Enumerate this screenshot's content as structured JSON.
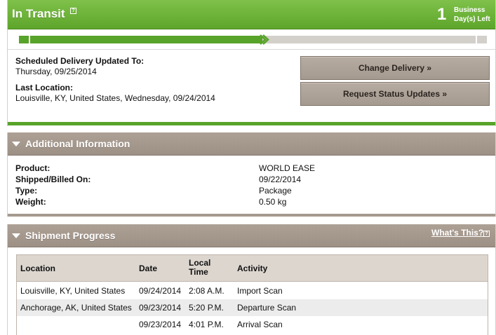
{
  "status": {
    "title": "In Transit",
    "days_count": "1",
    "days_label_line1": "Business",
    "days_label_line2": "Day(s) Left",
    "progress_fraction": 0.52,
    "colors": {
      "green": "#5ea52b",
      "taupe": "#a59a8f"
    }
  },
  "delivery": {
    "scheduled_label": "Scheduled Delivery Updated To:",
    "scheduled_value": "Thursday, 09/25/2014",
    "last_location_label": "Last Location:",
    "last_location_value": "Louisville, KY, United States, Wednesday, 09/24/2014"
  },
  "actions": {
    "change_delivery": "Change Delivery »",
    "request_updates": "Request Status Updates »"
  },
  "additional_info": {
    "title": "Additional Information",
    "rows": [
      {
        "key": "Product:",
        "value": "WORLD EASE"
      },
      {
        "key": "Shipped/Billed On:",
        "value": "09/22/2014"
      },
      {
        "key": "Type:",
        "value": "Package"
      },
      {
        "key": "Weight:",
        "value": "0.50 kg"
      }
    ]
  },
  "shipment_progress": {
    "title": "Shipment Progress",
    "whats_this": "What's This?",
    "headers": {
      "location": "Location",
      "date": "Date",
      "local_time_1": "Local",
      "local_time_2": "Time",
      "activity": "Activity"
    },
    "rows": [
      {
        "location": "Louisville, KY, United States",
        "date": "09/24/2014",
        "time": "2:08 A.M.",
        "activity": "Import Scan"
      },
      {
        "location": "Anchorage, AK, United States",
        "date": "09/23/2014",
        "time": "5:20 P.M.",
        "activity": "Departure Scan"
      },
      {
        "location": "",
        "date": "09/23/2014",
        "time": "4:01 P.M.",
        "activity": "Arrival Scan"
      }
    ]
  },
  "icons": {
    "help": "help-icon",
    "collapse": "triangle-down-icon",
    "progress_marker": "chevron-right-icon"
  }
}
